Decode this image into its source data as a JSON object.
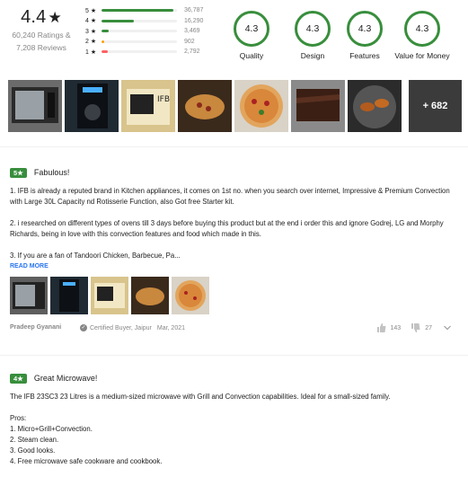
{
  "overall": {
    "rating": "4.4",
    "star": "★",
    "ratings_count": "60,240 Ratings &",
    "reviews_count": "7,208 Reviews"
  },
  "distribution": [
    {
      "label": "5 ★",
      "count": "36,787",
      "fraction": 0.95,
      "color": "#388e3c"
    },
    {
      "label": "4 ★",
      "count": "16,290",
      "fraction": 0.43,
      "color": "#388e3c"
    },
    {
      "label": "3 ★",
      "count": "3,469",
      "fraction": 0.09,
      "color": "#388e3c"
    },
    {
      "label": "2 ★",
      "count": "902",
      "fraction": 0.03,
      "color": "#ff9f00"
    },
    {
      "label": "1 ★",
      "count": "2,792",
      "fraction": 0.08,
      "color": "#ff6161"
    }
  ],
  "aspects": [
    {
      "score": "4.3",
      "label": "Quality"
    },
    {
      "score": "4.3",
      "label": "Design"
    },
    {
      "score": "4.3",
      "label": "Features"
    },
    {
      "score": "4.3",
      "label": "Value for Money"
    }
  ],
  "gallery": {
    "more_label": "+ 682"
  },
  "reviews": [
    {
      "badge": "5★",
      "title": "Fabulous!",
      "paragraphs": [
        "1. IFB is already a reputed brand in Kitchen appliances, it comes on 1st no. when you search over internet, Impressive & Premium Convection with Large 30L Capacity nd Rotisserie Function, also Got free Starter kit.",
        "2. i researched on different types of ovens till 3 days before buying this product but at the end i order this and ignore Godrej, LG and Morphy Richards, being in love with this convection features and food which made in this.",
        "3. If you are a fan of Tandoori Chicken, Barbecue, Pa..."
      ],
      "read_more": "READ MORE",
      "author": "Pradeep Gyanani",
      "certified": "Certified Buyer, Jaipur",
      "date": "Mar, 2021",
      "likes": "143",
      "dislikes": "27"
    },
    {
      "badge": "4★",
      "title": "Great Microwave!",
      "intro": "The IFB 23SC3 23 Litres is a medium-sized microwave with Grill and Convection capabilities. Ideal for a small-sized family.",
      "pros_title": "Pros:",
      "pros": [
        "1. Micro+Grill+Convection.",
        "2. Steam clean.",
        "3. Good looks.",
        "4. Free microwave safe cookware and cookbook."
      ]
    }
  ]
}
